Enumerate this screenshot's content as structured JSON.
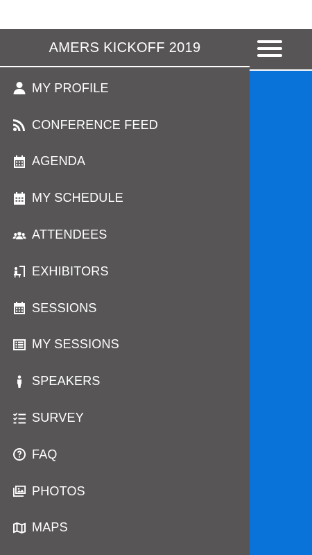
{
  "header": {
    "title": "AMERS KICKOFF 2019",
    "menu_icon": "hamburger-menu-icon"
  },
  "menu": {
    "items": [
      {
        "label": "MY PROFILE",
        "icon": "user-icon"
      },
      {
        "label": "CONFERENCE FEED",
        "icon": "rss-feed-icon"
      },
      {
        "label": "AGENDA",
        "icon": "calendar-icon"
      },
      {
        "label": "MY SCHEDULE",
        "icon": "calendar-filled-icon"
      },
      {
        "label": "ATTENDEES",
        "icon": "users-group-icon"
      },
      {
        "label": "EXHIBITORS",
        "icon": "exhibitor-booth-icon"
      },
      {
        "label": "SESSIONS",
        "icon": "calendar-icon"
      },
      {
        "label": "MY SESSIONS",
        "icon": "list-table-icon"
      },
      {
        "label": "SPEAKERS",
        "icon": "speaker-person-icon"
      },
      {
        "label": "SURVEY",
        "icon": "checklist-icon"
      },
      {
        "label": "FAQ",
        "icon": "question-circle-icon"
      },
      {
        "label": "PHOTOS",
        "icon": "photos-icon"
      },
      {
        "label": "MAPS",
        "icon": "map-icon"
      }
    ]
  },
  "colors": {
    "header_bg": "#575556",
    "drawer_bg": "#575556",
    "accent_blue": "#0a73d9",
    "text": "#ffffff"
  }
}
